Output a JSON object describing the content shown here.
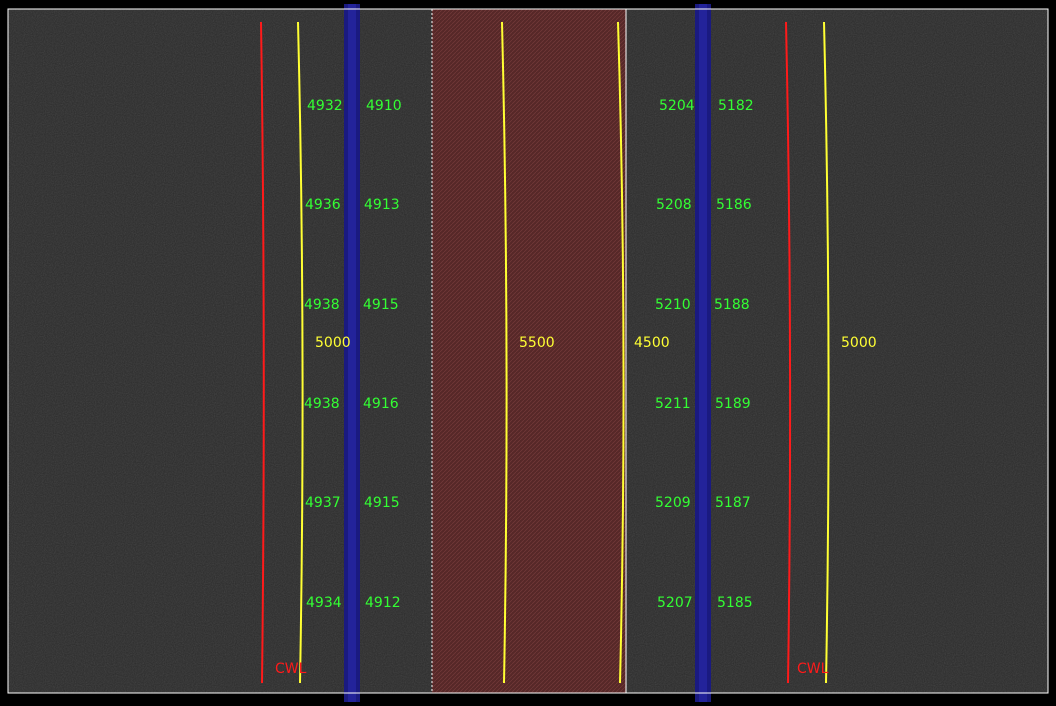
{
  "colors": {
    "background": "#2a2a2a",
    "border": "#ffffff",
    "cwl_line": "#ff1a1a",
    "contour_line": "#ffff33",
    "slit_band": "#1a1a80",
    "region_fill": "#5a2626",
    "wave_label": "#33ff33",
    "contour_label": "#ffff33",
    "cwl_label": "#ff1a1a"
  },
  "left_column_labels": [
    {
      "a": "4932",
      "b": "4910"
    },
    {
      "a": "4936",
      "b": "4913"
    },
    {
      "a": "4938",
      "b": "4915"
    },
    {
      "a": "4938",
      "b": "4916"
    },
    {
      "a": "4937",
      "b": "4915"
    },
    {
      "a": "4934",
      "b": "4912"
    }
  ],
  "right_column_labels": [
    {
      "a": "5204",
      "b": "5182"
    },
    {
      "a": "5208",
      "b": "5186"
    },
    {
      "a": "5210",
      "b": "5188"
    },
    {
      "a": "5211",
      "b": "5189"
    },
    {
      "a": "5209",
      "b": "5187"
    },
    {
      "a": "5207",
      "b": "5185"
    }
  ],
  "contour_labels": {
    "left": "5000",
    "middle": "5500",
    "middle_right": "4500",
    "right": "5000"
  },
  "cwl_labels": {
    "left": "CWL",
    "right": "CWL"
  }
}
